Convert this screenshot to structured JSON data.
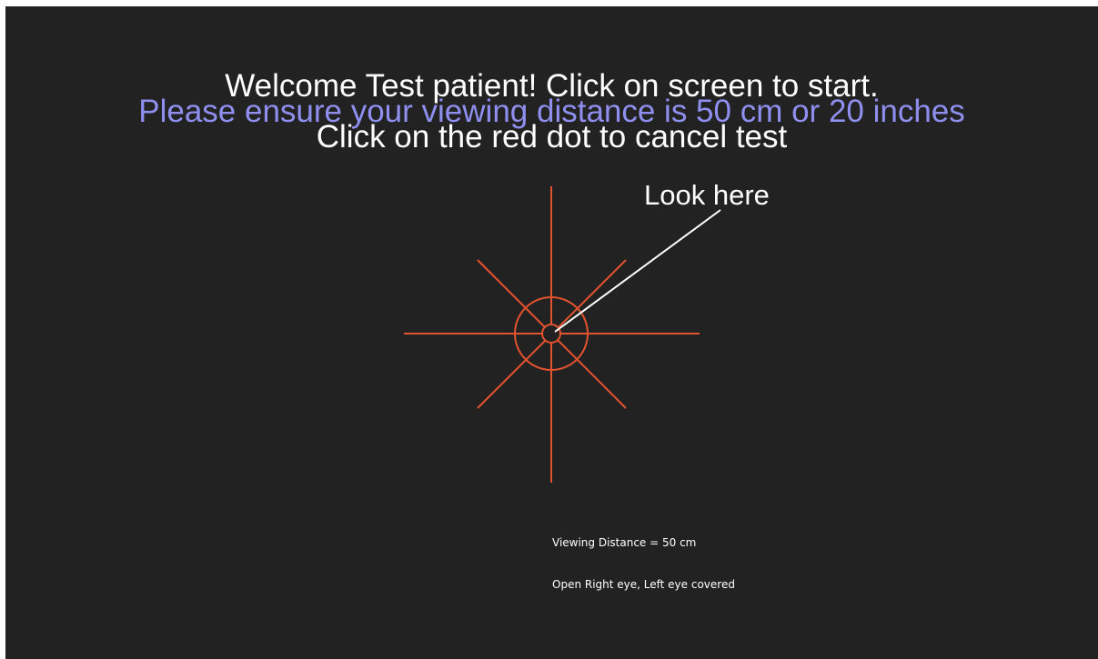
{
  "messages": {
    "welcome": "Welcome Test patient! Click on screen to start.",
    "distance_note": "Please ensure your viewing distance is 50 cm or 20 inches",
    "cancel_note": "Click on the red dot to cancel test"
  },
  "fixation": {
    "pointer_label": "Look here",
    "icon": "fixation-target-icon"
  },
  "info": {
    "viewing_distance": "Viewing Distance = 50 cm",
    "eye_instruction": "Open Right eye, Left eye covered"
  },
  "colors": {
    "background": "#222222",
    "target": "#e4532f",
    "distance_note": "#8f8ff0",
    "text": "#ffffff"
  }
}
